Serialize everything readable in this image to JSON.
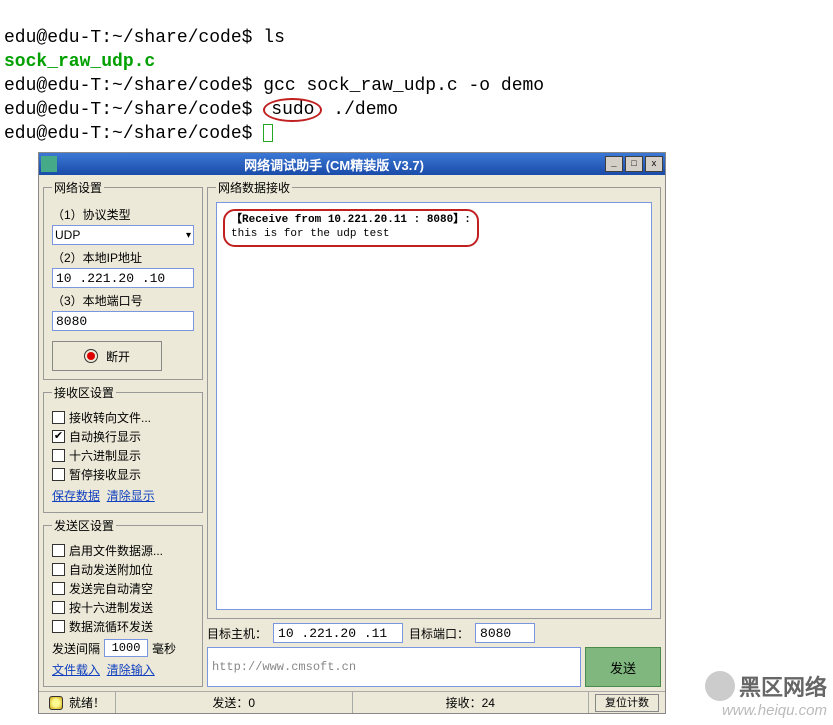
{
  "terminal": {
    "prompt": "edu@edu-T:~/share/code$",
    "cmd_ls": "ls",
    "file": "sock_raw_udp.c",
    "cmd_gcc": "gcc sock_raw_udp.c -o demo",
    "sudo": "sudo",
    "cmd_demo": "./demo"
  },
  "app": {
    "title": "网络调试助手 (CM精装版 V3.7)",
    "win_min": "_",
    "win_max": "□",
    "win_close": "x"
  },
  "net_settings": {
    "legend": "网络设置",
    "proto_label": "（1）协议类型",
    "proto_value": "UDP",
    "ip_label": "（2）本地IP地址",
    "ip_value": "10 .221.20 .10",
    "port_label": "（3）本地端口号",
    "port_value": "8080",
    "disconnect": "断开"
  },
  "recv_settings": {
    "legend": "接收区设置",
    "to_file": "接收转向文件...",
    "auto_wrap": "自动换行显示",
    "hex": "十六进制显示",
    "pause": "暂停接收显示",
    "save": "保存数据",
    "clear": "清除显示"
  },
  "send_settings": {
    "legend": "发送区设置",
    "file_src": "启用文件数据源...",
    "auto_append": "自动发送附加位",
    "auto_clear": "发送完自动清空",
    "hex_send": "按十六进制发送",
    "loop_send": "数据流循环发送",
    "interval_label": "发送间隔",
    "interval_value": "1000",
    "interval_unit": "毫秒",
    "file_load": "文件载入",
    "clear_input": "清除输入"
  },
  "recv_panel": {
    "legend": "网络数据接收",
    "line1": "【Receive from 10.221.20.11 : 8080】:",
    "line2": "this is for the udp test"
  },
  "target": {
    "host_label": "目标主机：",
    "host_value": "10 .221.20 .11",
    "port_label": "目标端口：",
    "port_value": "8080"
  },
  "send": {
    "url": "http://www.cmsoft.cn",
    "button": "发送"
  },
  "status": {
    "ready": "就绪！",
    "sent_label": "发送：",
    "sent_value": "0",
    "recv_label": "接收：",
    "recv_value": "24",
    "reset": "复位计数"
  },
  "watermark": {
    "big": "黑区网络",
    "small": "www.heiqu.com"
  }
}
